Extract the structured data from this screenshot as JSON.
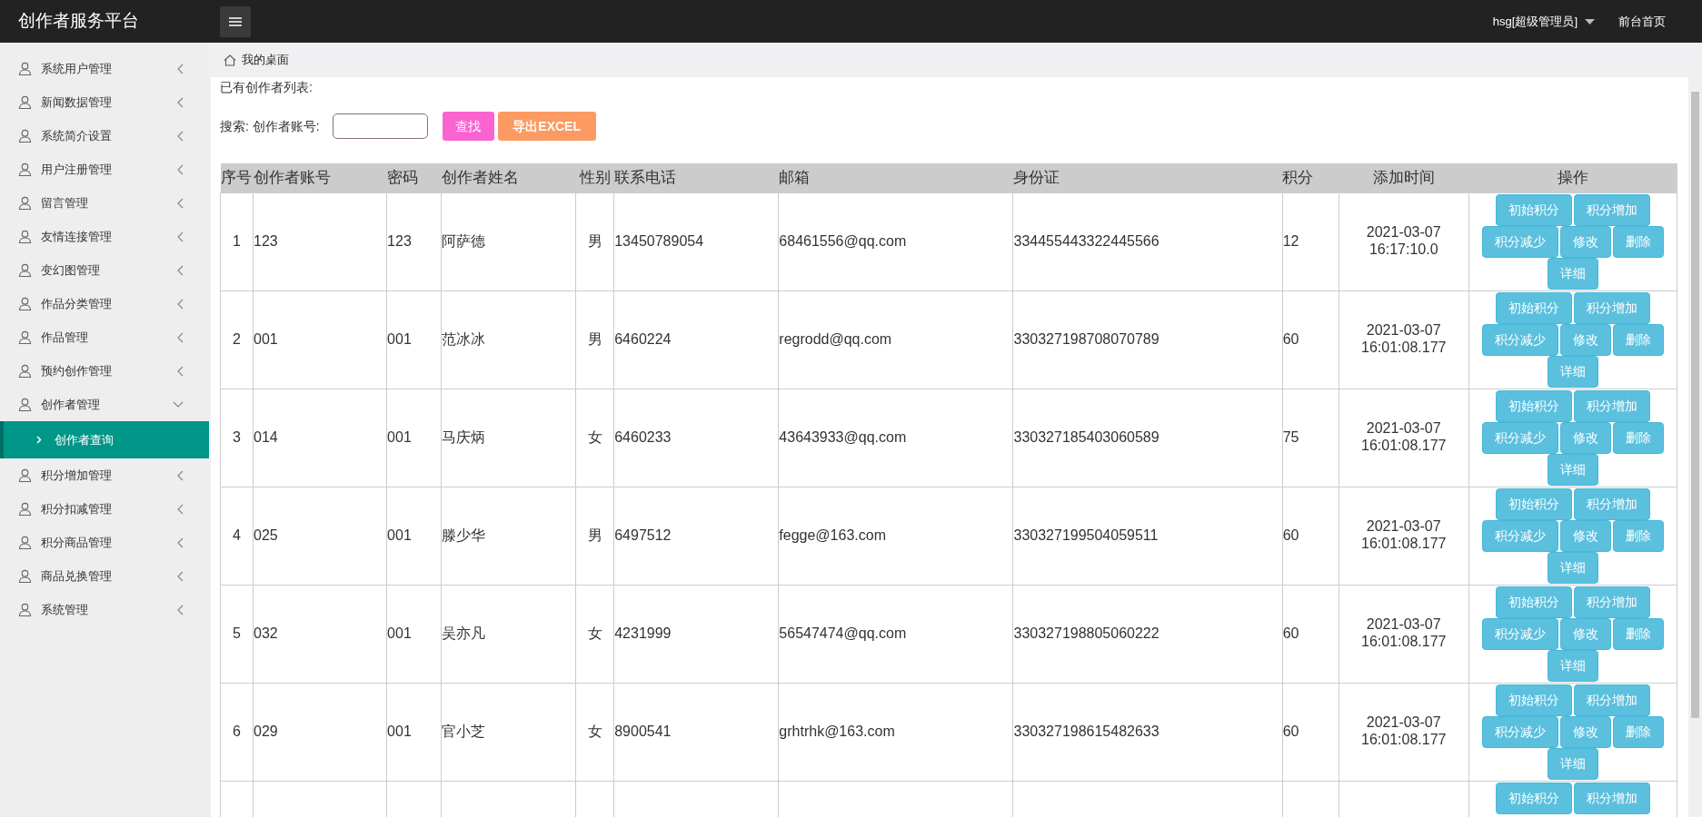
{
  "header": {
    "title": "创作者服务平台",
    "user": "hsg[超级管理员]",
    "home_link": "前台首页"
  },
  "sidebar": {
    "items": [
      {
        "label": "系统用户管理",
        "expanded": false
      },
      {
        "label": "新闻数据管理",
        "expanded": false
      },
      {
        "label": "系统简介设置",
        "expanded": false
      },
      {
        "label": "用户注册管理",
        "expanded": false
      },
      {
        "label": "留言管理",
        "expanded": false
      },
      {
        "label": "友情连接管理",
        "expanded": false
      },
      {
        "label": "变幻图管理",
        "expanded": false
      },
      {
        "label": "作品分类管理",
        "expanded": false
      },
      {
        "label": "作品管理",
        "expanded": false
      },
      {
        "label": "预约创作管理",
        "expanded": false
      },
      {
        "label": "创作者管理",
        "expanded": true,
        "children": [
          {
            "label": "创作者查询",
            "selected": true
          }
        ]
      },
      {
        "label": "积分增加管理",
        "expanded": false
      },
      {
        "label": "积分扣减管理",
        "expanded": false
      },
      {
        "label": "积分商品管理",
        "expanded": false
      },
      {
        "label": "商品兑换管理",
        "expanded": false
      },
      {
        "label": "系统管理",
        "expanded": false
      }
    ]
  },
  "breadcrumb": "我的桌面",
  "list_title": "已有创作者列表:",
  "search": {
    "label": "搜索: 创作者账号:",
    "find_button": "查找",
    "export_button": "导出EXCEL"
  },
  "table": {
    "columns": [
      "序号",
      "创作者账号",
      "密码",
      "创作者姓名",
      "性别",
      "联系电话",
      "邮箱",
      "身份证",
      "积分",
      "添加时间",
      "操作"
    ],
    "rows": [
      {
        "cells": [
          "1",
          "123",
          "123",
          "阿萨德",
          "男",
          "13450789054",
          "68461556@qq.com",
          "334455443322445566",
          "12",
          "2021-03-07 16:17:10.0"
        ],
        "actions": [
          "初始积分",
          "积分增加",
          "积分减少",
          "修改",
          "删除",
          "详细"
        ]
      },
      {
        "cells": [
          "2",
          "001",
          "001",
          "范冰冰",
          "男",
          "6460224",
          "regrodd@qq.com",
          "330327198708070789",
          "60",
          "2021-03-07 16:01:08.177"
        ],
        "actions": [
          "初始积分",
          "积分增加",
          "积分减少",
          "修改",
          "删除",
          "详细"
        ]
      },
      {
        "cells": [
          "3",
          "014",
          "001",
          "马庆炳",
          "女",
          "6460233",
          "43643933@qq.com",
          "330327185403060589",
          "75",
          "2021-03-07 16:01:08.177"
        ],
        "actions": [
          "初始积分",
          "积分增加",
          "积分减少",
          "修改",
          "删除",
          "详细"
        ]
      },
      {
        "cells": [
          "4",
          "025",
          "001",
          "滕少华",
          "男",
          "6497512",
          "fegge@163.com",
          "330327199504059511",
          "60",
          "2021-03-07 16:01:08.177"
        ],
        "actions": [
          "初始积分",
          "积分增加",
          "积分减少",
          "修改",
          "删除",
          "详细"
        ]
      },
      {
        "cells": [
          "5",
          "032",
          "001",
          "吴亦凡",
          "女",
          "4231999",
          "56547474@qq.com",
          "330327198805060222",
          "60",
          "2021-03-07 16:01:08.177"
        ],
        "actions": [
          "初始积分",
          "积分增加",
          "积分减少",
          "修改",
          "删除",
          "详细"
        ]
      },
      {
        "cells": [
          "6",
          "029",
          "001",
          "官小芝",
          "女",
          "8900541",
          "grhtrhk@163.com",
          "330327198615482633",
          "60",
          "2021-03-07 16:01:08.177"
        ],
        "actions": [
          "初始积分",
          "积分增加",
          "积分减少",
          "修改",
          "删除",
          "详细"
        ]
      },
      {
        "cells": [],
        "actions": [
          "初始积分",
          "积分增加"
        ]
      }
    ]
  }
}
